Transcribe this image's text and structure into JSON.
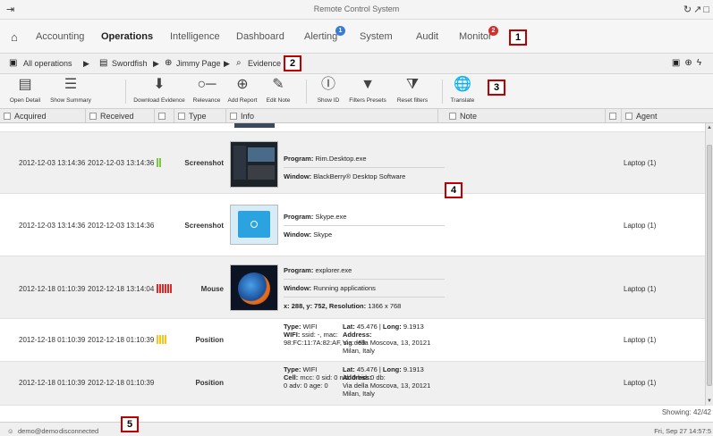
{
  "app": {
    "title": "Remote Control System"
  },
  "nav": {
    "items": [
      {
        "label": "Accounting"
      },
      {
        "label": "Operations"
      },
      {
        "label": "Intelligence"
      },
      {
        "label": "Dashboard"
      },
      {
        "label": "Alerting",
        "badge": "1"
      },
      {
        "label": "System"
      },
      {
        "label": "Audit"
      },
      {
        "label": "Monitor",
        "badge": "2"
      }
    ]
  },
  "breadcrumb": {
    "items": [
      "All operations",
      "Swordfish",
      "Jimmy Page",
      "Evidence"
    ]
  },
  "callouts": [
    "1",
    "2",
    "3",
    "4",
    "5"
  ],
  "toolbar": {
    "buttons": [
      {
        "label": "Open Detail",
        "icon": "document-icon"
      },
      {
        "label": "Show Summary",
        "icon": "summary-icon"
      },
      {
        "label": "Download Evidence",
        "icon": "download-icon"
      },
      {
        "label": "Relevance",
        "icon": "relevance-slider-icon"
      },
      {
        "label": "Add Report",
        "icon": "add-report-icon"
      },
      {
        "label": "Edit Note",
        "icon": "edit-note-icon"
      },
      {
        "label": "Show ID",
        "icon": "id-icon"
      },
      {
        "label": "Filters Presets",
        "icon": "filter-icon"
      },
      {
        "label": "Reset filters",
        "icon": "reset-filter-icon"
      },
      {
        "label": "Translate",
        "icon": "globe-icon"
      }
    ]
  },
  "columns": {
    "acquired": "Acquired",
    "received": "Received",
    "type": "Type",
    "info": "Info",
    "note": "Note",
    "agent": "Agent"
  },
  "rows": [
    {
      "acquired": "2012-12-03 13:14:36",
      "received": "2012-12-03 13:14:36",
      "relevance_color": "#7ac943",
      "relevance_count": 1,
      "type": "Screenshot",
      "info_program_label": "Program:",
      "info_program": "Rim.Desktop.exe",
      "info_window_label": "Window:",
      "info_window": "BlackBerry® Desktop Software",
      "agent": "Laptop (1)"
    },
    {
      "acquired": "2012-12-03 13:14:36",
      "received": "2012-12-03 13:14:36",
      "relevance_count": 0,
      "type": "Screenshot",
      "info_program_label": "Program:",
      "info_program": "Skype.exe",
      "info_window_label": "Window:",
      "info_window": "Skype",
      "agent": "Laptop (1)"
    },
    {
      "acquired": "2012-12-18 01:10:39",
      "received": "2012-12-18 13:14:04",
      "relevance_color": "#e02a2a",
      "relevance_count": 4,
      "type": "Mouse",
      "info_program_label": "Program:",
      "info_program": "explorer.exe",
      "info_window_label": "Window:",
      "info_window": "Running applications",
      "info_coords": "x: 288, y: 752,",
      "info_resolution_label": "Resolution:",
      "info_resolution": "1366 x 768",
      "agent": "Laptop (1)"
    },
    {
      "acquired": "2012-12-18 01:10:39",
      "received": "2012-12-18 01:10:39",
      "relevance_color": "#f5c518",
      "relevance_count": 3,
      "type": "Position",
      "info_type_label": "Type:",
      "info_type": "WIFI",
      "info_detail_label": "WIFI:",
      "info_detail": "ssid: -, mac:",
      "info_detail2": "98:FC:11:7A:82:AF, sig: -69",
      "info_lat_label": "Lat:",
      "info_lat": "45.476",
      "info_long_label": "Long:",
      "info_long": "9.1913",
      "info_address_label": "Address:",
      "info_address1": "Via della Moscova, 13, 20121",
      "info_address2": "Milan, Italy",
      "agent": "Laptop (1)"
    },
    {
      "acquired": "2012-12-18 01:10:39",
      "received": "2012-12-18 01:10:39",
      "relevance_count": 0,
      "type": "Position",
      "info_type_label": "Type:",
      "info_type": "WIFI",
      "info_detail_label": "Cell:",
      "info_detail": "mcc: 0 sid: 0 nid: 0 bid: 0 db:",
      "info_detail2": "0 adv: 0 age: 0",
      "info_lat_label": "Lat:",
      "info_lat": "45.476",
      "info_long_label": "Long:",
      "info_long": "9.1913",
      "info_address_label": "Address:",
      "info_address1": "Via della Moscova, 13, 20121",
      "info_address2": "Milan, Italy",
      "agent": "Laptop (1)"
    }
  ],
  "grid": {
    "showing": "Showing: 42/42"
  },
  "status": {
    "user": "demo@demo",
    "connection": "disconnected",
    "datetime": "Fri, Sep 27  14:57:5"
  }
}
